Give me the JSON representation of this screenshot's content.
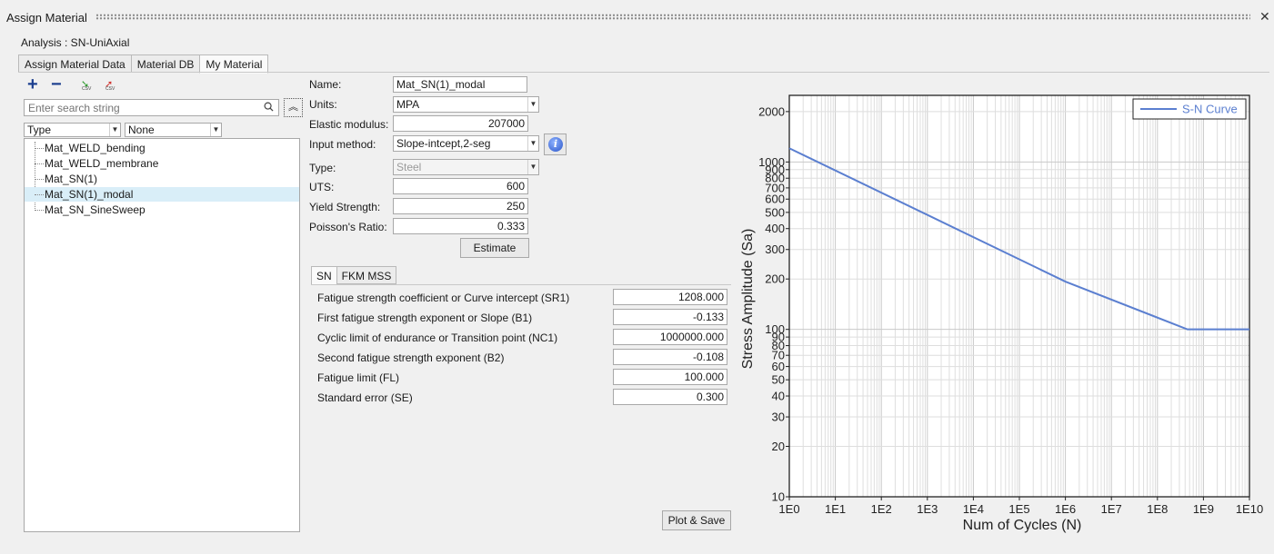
{
  "window": {
    "title": "Assign Material",
    "close_glyph": "✕"
  },
  "analysis_label": "Analysis : SN-UniAxial",
  "tabs": [
    {
      "label": "Assign Material Data"
    },
    {
      "label": "Material DB"
    },
    {
      "label": "My Material"
    }
  ],
  "toolbar": {
    "add_icon": "plus-icon",
    "remove_icon": "minus-icon",
    "import_csv_icon": "csv-import-icon",
    "export_csv_icon": "csv-export-icon",
    "csv_text": "CSV"
  },
  "search": {
    "placeholder": "Enter search string",
    "collapse_glyph": "⌃"
  },
  "filters": {
    "type": "Type",
    "value": "None"
  },
  "materials": [
    {
      "label": "Mat_WELD_bending"
    },
    {
      "label": "Mat_WELD_membrane"
    },
    {
      "label": "Mat_SN(1)"
    },
    {
      "label": "Mat_SN(1)_modal"
    },
    {
      "label": "Mat_SN_SineSweep"
    }
  ],
  "form": {
    "name": {
      "label": "Name:",
      "value": "Mat_SN(1)_modal"
    },
    "units": {
      "label": "Units:",
      "value": "MPA"
    },
    "elastic_modulus": {
      "label": "Elastic modulus:",
      "value": "207000"
    },
    "input_method": {
      "label": "Input method:",
      "value": "Slope-intcept,2-seg"
    },
    "type": {
      "label": "Type:",
      "value": "Steel"
    },
    "uts": {
      "label": "UTS:",
      "value": "600"
    },
    "yield_strength": {
      "label": "Yield Strength:",
      "value": "250"
    },
    "poisson_ratio": {
      "label": "Poisson's Ratio:",
      "value": "0.333"
    },
    "estimate_label": "Estimate",
    "info_glyph": "i"
  },
  "subtabs": [
    {
      "label": "SN"
    },
    {
      "label": "FKM MSS"
    }
  ],
  "params": [
    {
      "label": "Fatigue strength coefficient or Curve intercept (SR1)",
      "value": "1208.000"
    },
    {
      "label": "First fatigue strength exponent or Slope (B1)",
      "value": "-0.133"
    },
    {
      "label": "Cyclic limit of endurance or Transition point (NC1)",
      "value": "1000000.000"
    },
    {
      "label": "Second fatigue strength exponent (B2)",
      "value": "-0.108"
    },
    {
      "label": "Fatigue limit (FL)",
      "value": "100.000"
    },
    {
      "label": "Standard error (SE)",
      "value": "0.300"
    }
  ],
  "plot_save_label": "Plot & Save",
  "colors": {
    "series": "#5b7fd0",
    "accent": "#1c3f8f"
  },
  "chart_data": {
    "type": "line",
    "xscale": "log",
    "yscale": "log",
    "xlabel": "Num of Cycles (N)",
    "ylabel": "Stress Amplitude (Sa)",
    "xlim": [
      1,
      10000000000
    ],
    "ylim": [
      10,
      2500
    ],
    "grid": true,
    "legend_position": "top-right",
    "x_ticks": [
      "1E0",
      "1E1",
      "1E2",
      "1E3",
      "1E4",
      "1E5",
      "1E6",
      "1E7",
      "1E8",
      "1E9",
      "1E10"
    ],
    "y_ticks": [
      "2000",
      "1000",
      "900",
      "800",
      "700",
      "600",
      "500",
      "400",
      "300",
      "200",
      "100",
      "90",
      "80",
      "70",
      "60",
      "50",
      "40",
      "30",
      "20",
      "10"
    ],
    "series": [
      {
        "name": "S-N Curve",
        "x": [
          1,
          1000000,
          450000000,
          10000000000
        ],
        "y": [
          1208,
          193,
          100,
          100
        ]
      }
    ]
  }
}
